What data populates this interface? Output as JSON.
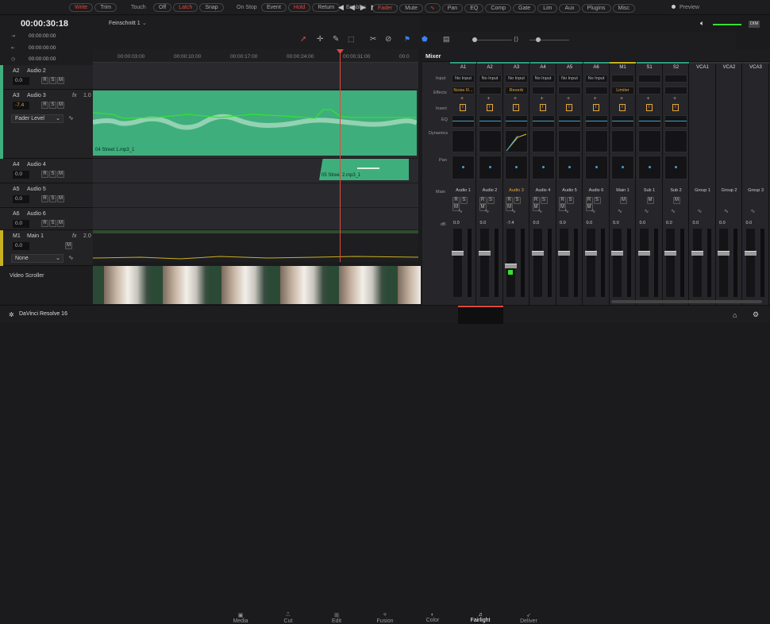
{
  "toolbar": {
    "automation": [
      "Write",
      "Trim"
    ],
    "touch_label": "Touch",
    "touch": [
      "Off",
      "Latch",
      "Snap"
    ],
    "onstop_label": "On Stop",
    "onstop": [
      "Event",
      "Hold",
      "Return"
    ],
    "enables_label": "Enables",
    "enables": [
      "Fader",
      "Mute",
      "Pan",
      "EQ",
      "Comp",
      "Gate",
      "Lim",
      "Aux",
      "Plugins",
      "Misc"
    ],
    "preview": "Preview",
    "dim": "DIM"
  },
  "timecodes": {
    "main": "00:00:30:18",
    "in": "00:00:00:00",
    "out": "00:00:00:00",
    "dur": "00:00:00:00"
  },
  "timeline_name": "Feinschnitt 1",
  "ruler": [
    "00:00:03:00",
    "00:00:10:00",
    "00:00:17:00",
    "00:00:24:00",
    "00:00:31:00",
    "00:0"
  ],
  "tracks": [
    {
      "id": "A2",
      "name": "Audio 2",
      "vol": "0.0"
    },
    {
      "id": "A3",
      "name": "Audio 3",
      "vol": "-7.4",
      "fx": "fx",
      "ch": "1.0",
      "mode": "Fader Level"
    },
    {
      "id": "A4",
      "name": "Audio 4",
      "vol": "0.0"
    },
    {
      "id": "A5",
      "name": "Audio 5",
      "vol": "0.0"
    },
    {
      "id": "A6",
      "name": "Audio 6",
      "vol": "0.0"
    },
    {
      "id": "M1",
      "name": "Main 1",
      "vol": "0.0",
      "fx": "fx",
      "ch": "2.0",
      "mode": "None"
    }
  ],
  "solo_labels": {
    "r": "R",
    "s": "S",
    "m": "M"
  },
  "clips": {
    "clip1": "04 Street 1.mp3_1",
    "clip2": "05 Street 2.mp3_1"
  },
  "video_scroller": "Video Scroller",
  "mixer": {
    "title": "Mixer",
    "row_labels": {
      "input": "Input",
      "effects": "Effects",
      "insert": "Insert",
      "eq": "EQ",
      "dynamics": "Dynamics",
      "pan": "Pan",
      "main": "Main",
      "db": "dB"
    },
    "channels": [
      {
        "top": "A1",
        "input": "No Input",
        "effect": "Noise R...",
        "name": "Audio 1",
        "db": "0.0"
      },
      {
        "top": "A2",
        "input": "No Input",
        "effect": "",
        "name": "Audio 2",
        "db": "0.0"
      },
      {
        "top": "A3",
        "input": "No Input",
        "effect": "Reverb",
        "name": "Audio 3",
        "db": "-7.4"
      },
      {
        "top": "A4",
        "input": "No Input",
        "effect": "",
        "name": "Audio 4",
        "db": "0.0"
      },
      {
        "top": "A5",
        "input": "No Input",
        "effect": "",
        "name": "Audio 5",
        "db": "0.0"
      },
      {
        "top": "A6",
        "input": "No Input",
        "effect": "",
        "name": "Audio 6",
        "db": "0.0"
      },
      {
        "top": "M1",
        "input": "",
        "effect": "Limiter",
        "name": "Main 1",
        "db": "0.0"
      },
      {
        "top": "S1",
        "input": "",
        "effect": "",
        "name": "Sub 1",
        "db": "0.0"
      },
      {
        "top": "S2",
        "input": "",
        "effect": "",
        "name": "Sub 2",
        "db": "0.0"
      },
      {
        "top": "VCA1",
        "input": "",
        "effect": "",
        "name": "Group 1",
        "db": "0.0"
      },
      {
        "top": "VCA2",
        "input": "",
        "effect": "",
        "name": "Group 2",
        "db": "0.0"
      },
      {
        "top": "VCA3",
        "input": "",
        "effect": "",
        "name": "Group 3",
        "db": "0.0"
      }
    ]
  },
  "app": {
    "name": "DaVinci Resolve 16"
  },
  "pages": [
    "Media",
    "Cut",
    "Edit",
    "Fusion",
    "Color",
    "Fairlight",
    "Deliver"
  ],
  "colors": {
    "accent": "#e0483b",
    "clip": "#3fae7d",
    "wave": "#d8f0e0",
    "automation": "#35e22f",
    "active_page": "#ffffff"
  }
}
